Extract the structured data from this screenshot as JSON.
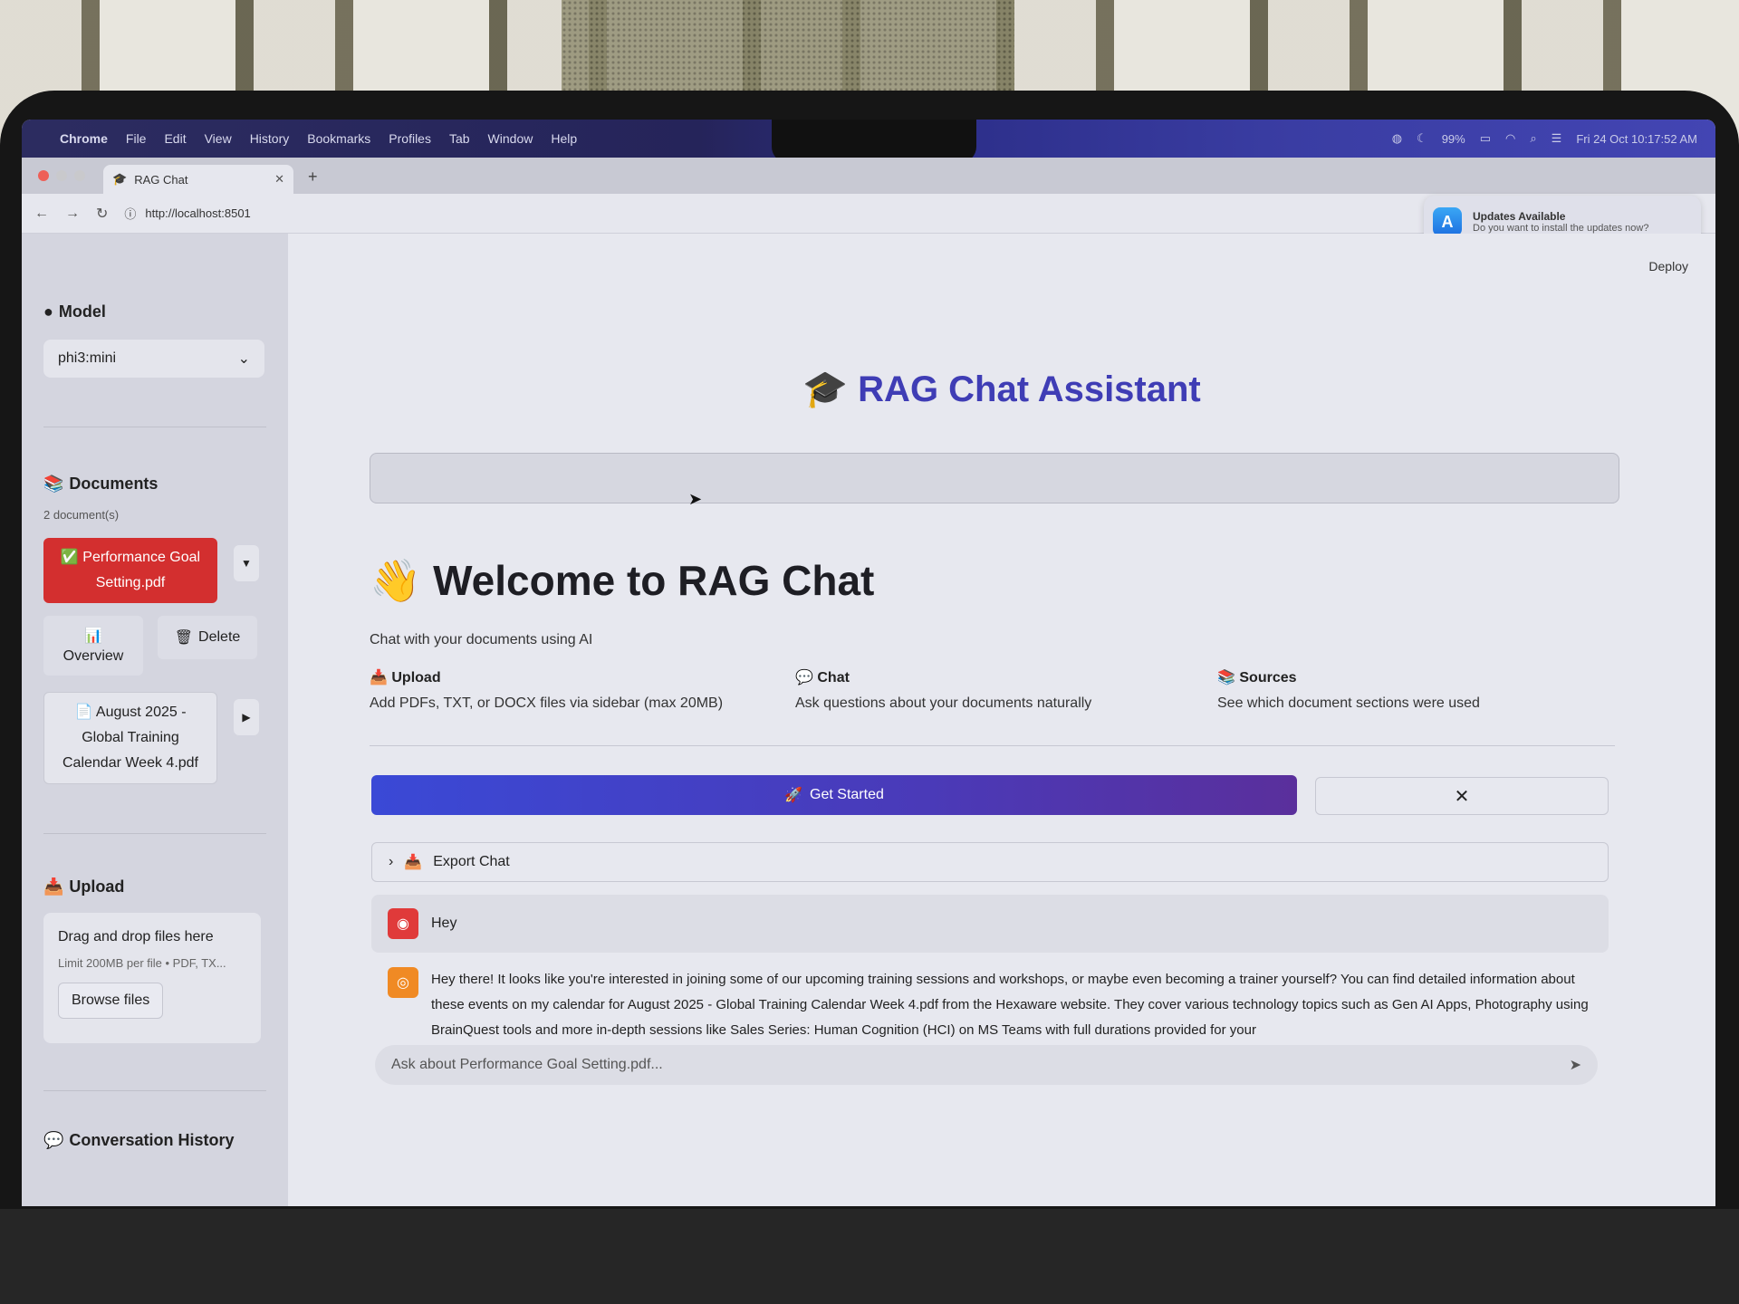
{
  "menubar": {
    "items": [
      "Chrome",
      "File",
      "Edit",
      "View",
      "History",
      "Bookmarks",
      "Profiles",
      "Tab",
      "Window",
      "Help"
    ],
    "battery": "99%",
    "datetime": "Fri 24 Oct  10:17:52 AM"
  },
  "browser": {
    "tab_title": "RAG Chat",
    "url": "http://localhost:8501"
  },
  "notification": {
    "title": "Updates Available",
    "body": "Do you want to install the updates now?"
  },
  "sidebar": {
    "model_heading": "Model",
    "model_value": "phi3:mini",
    "documents_heading": "Documents",
    "doc_count": "2 document(s)",
    "docs": [
      {
        "name": "Performance Goal Setting.pdf",
        "active": true
      },
      {
        "name": "August 2025 - Global Training Calendar Week 4.pdf",
        "active": false
      }
    ],
    "overview_label": "Overview",
    "delete_label": "Delete",
    "upload_heading": "Upload",
    "upload_drag": "Drag and drop files here",
    "upload_limit": "Limit 200MB per file • PDF, TX...",
    "browse_label": "Browse files",
    "history_heading": "Conversation History"
  },
  "main": {
    "deploy": "Deploy",
    "title": "RAG Chat Assistant",
    "welcome": "Welcome to RAG Chat",
    "subtitle": "Chat with your documents using AI",
    "features": [
      {
        "title": "Upload",
        "desc": "Add PDFs, TXT, or DOCX files via sidebar (max 20MB)"
      },
      {
        "title": "Chat",
        "desc": "Ask questions about your documents naturally"
      },
      {
        "title": "Sources",
        "desc": "See which document sections were used"
      }
    ],
    "get_started": "Get Started",
    "export_chat": "Export Chat",
    "user_message": "Hey",
    "assistant_message": "Hey there! It looks like you're interested in joining some of our upcoming training sessions and workshops, or maybe even becoming a trainer yourself? You can find detailed information about these events on my calendar for August 2025 - Global Training Calendar Week 4.pdf from the Hexaware website. They cover various technology topics such as Gen AI Apps, Photography using BrainQuest tools and more in-depth sessions like Sales Series: Human Cognition (HCI) on MS Teams with full durations provided for your",
    "input_placeholder": "Ask about Performance Goal Setting.pdf..."
  },
  "colors": {
    "title": "#3f3db5",
    "active_doc": "#d32f2f",
    "button_gradient_start": "#3a49d6",
    "button_gradient_end": "#5a2f9c"
  }
}
